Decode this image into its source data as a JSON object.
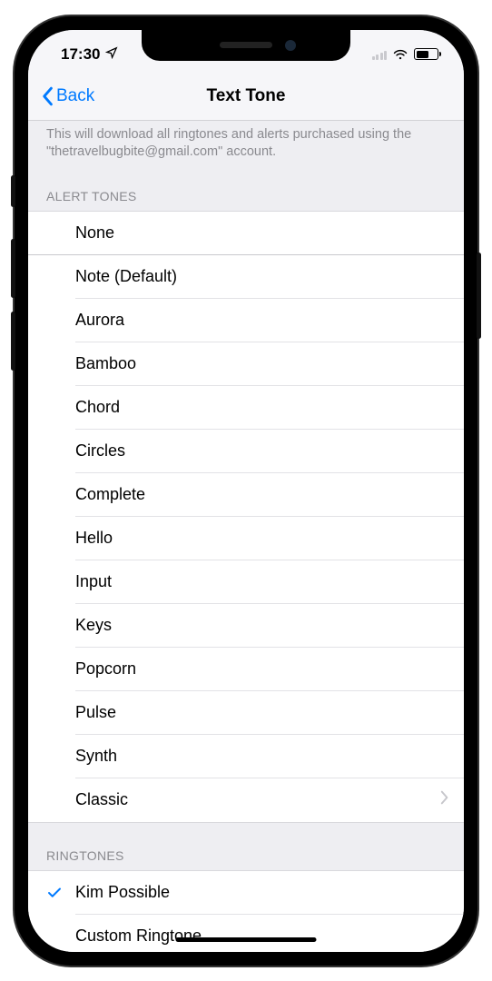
{
  "status": {
    "time": "17:30"
  },
  "nav": {
    "back_label": "Back",
    "title": "Text Tone"
  },
  "info_text": "This will download all ringtones and alerts purchased using the \"thetravelbugbite@gmail.com\" account.",
  "sections": {
    "alert_tones": {
      "header": "ALERT TONES",
      "items": [
        {
          "label": "None",
          "selected": false,
          "full_sep": true
        },
        {
          "label": "Note (Default)",
          "selected": false
        },
        {
          "label": "Aurora",
          "selected": false
        },
        {
          "label": "Bamboo",
          "selected": false
        },
        {
          "label": "Chord",
          "selected": false
        },
        {
          "label": "Circles",
          "selected": false
        },
        {
          "label": "Complete",
          "selected": false
        },
        {
          "label": "Hello",
          "selected": false
        },
        {
          "label": "Input",
          "selected": false
        },
        {
          "label": "Keys",
          "selected": false
        },
        {
          "label": "Popcorn",
          "selected": false
        },
        {
          "label": "Pulse",
          "selected": false
        },
        {
          "label": "Synth",
          "selected": false
        },
        {
          "label": "Classic",
          "selected": false,
          "disclosure": true
        }
      ]
    },
    "ringtones": {
      "header": "RINGTONES",
      "items": [
        {
          "label": "Kim Possible",
          "selected": true
        },
        {
          "label": "Custom Ringtone",
          "selected": false
        }
      ]
    }
  }
}
